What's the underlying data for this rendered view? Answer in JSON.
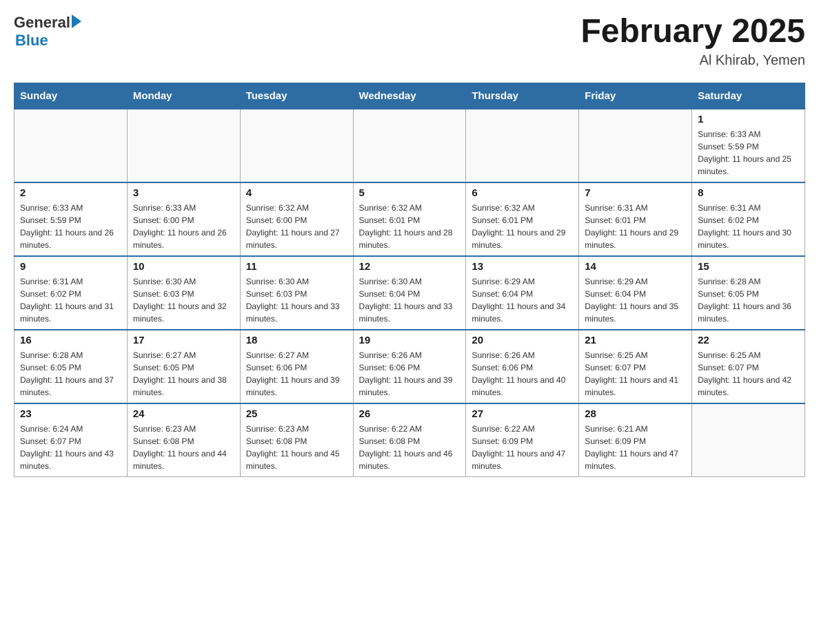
{
  "header": {
    "logo": {
      "general": "General",
      "blue": "Blue"
    },
    "title": "February 2025",
    "location": "Al Khirab, Yemen"
  },
  "days_of_week": [
    "Sunday",
    "Monday",
    "Tuesday",
    "Wednesday",
    "Thursday",
    "Friday",
    "Saturday"
  ],
  "weeks": [
    {
      "days": [
        {
          "num": "",
          "empty": true
        },
        {
          "num": "",
          "empty": true
        },
        {
          "num": "",
          "empty": true
        },
        {
          "num": "",
          "empty": true
        },
        {
          "num": "",
          "empty": true
        },
        {
          "num": "",
          "empty": true
        },
        {
          "num": "1",
          "sunrise": "Sunrise: 6:33 AM",
          "sunset": "Sunset: 5:59 PM",
          "daylight": "Daylight: 11 hours and 25 minutes."
        }
      ]
    },
    {
      "days": [
        {
          "num": "2",
          "sunrise": "Sunrise: 6:33 AM",
          "sunset": "Sunset: 5:59 PM",
          "daylight": "Daylight: 11 hours and 26 minutes."
        },
        {
          "num": "3",
          "sunrise": "Sunrise: 6:33 AM",
          "sunset": "Sunset: 6:00 PM",
          "daylight": "Daylight: 11 hours and 26 minutes."
        },
        {
          "num": "4",
          "sunrise": "Sunrise: 6:32 AM",
          "sunset": "Sunset: 6:00 PM",
          "daylight": "Daylight: 11 hours and 27 minutes."
        },
        {
          "num": "5",
          "sunrise": "Sunrise: 6:32 AM",
          "sunset": "Sunset: 6:01 PM",
          "daylight": "Daylight: 11 hours and 28 minutes."
        },
        {
          "num": "6",
          "sunrise": "Sunrise: 6:32 AM",
          "sunset": "Sunset: 6:01 PM",
          "daylight": "Daylight: 11 hours and 29 minutes."
        },
        {
          "num": "7",
          "sunrise": "Sunrise: 6:31 AM",
          "sunset": "Sunset: 6:01 PM",
          "daylight": "Daylight: 11 hours and 29 minutes."
        },
        {
          "num": "8",
          "sunrise": "Sunrise: 6:31 AM",
          "sunset": "Sunset: 6:02 PM",
          "daylight": "Daylight: 11 hours and 30 minutes."
        }
      ]
    },
    {
      "days": [
        {
          "num": "9",
          "sunrise": "Sunrise: 6:31 AM",
          "sunset": "Sunset: 6:02 PM",
          "daylight": "Daylight: 11 hours and 31 minutes."
        },
        {
          "num": "10",
          "sunrise": "Sunrise: 6:30 AM",
          "sunset": "Sunset: 6:03 PM",
          "daylight": "Daylight: 11 hours and 32 minutes."
        },
        {
          "num": "11",
          "sunrise": "Sunrise: 6:30 AM",
          "sunset": "Sunset: 6:03 PM",
          "daylight": "Daylight: 11 hours and 33 minutes."
        },
        {
          "num": "12",
          "sunrise": "Sunrise: 6:30 AM",
          "sunset": "Sunset: 6:04 PM",
          "daylight": "Daylight: 11 hours and 33 minutes."
        },
        {
          "num": "13",
          "sunrise": "Sunrise: 6:29 AM",
          "sunset": "Sunset: 6:04 PM",
          "daylight": "Daylight: 11 hours and 34 minutes."
        },
        {
          "num": "14",
          "sunrise": "Sunrise: 6:29 AM",
          "sunset": "Sunset: 6:04 PM",
          "daylight": "Daylight: 11 hours and 35 minutes."
        },
        {
          "num": "15",
          "sunrise": "Sunrise: 6:28 AM",
          "sunset": "Sunset: 6:05 PM",
          "daylight": "Daylight: 11 hours and 36 minutes."
        }
      ]
    },
    {
      "days": [
        {
          "num": "16",
          "sunrise": "Sunrise: 6:28 AM",
          "sunset": "Sunset: 6:05 PM",
          "daylight": "Daylight: 11 hours and 37 minutes."
        },
        {
          "num": "17",
          "sunrise": "Sunrise: 6:27 AM",
          "sunset": "Sunset: 6:05 PM",
          "daylight": "Daylight: 11 hours and 38 minutes."
        },
        {
          "num": "18",
          "sunrise": "Sunrise: 6:27 AM",
          "sunset": "Sunset: 6:06 PM",
          "daylight": "Daylight: 11 hours and 39 minutes."
        },
        {
          "num": "19",
          "sunrise": "Sunrise: 6:26 AM",
          "sunset": "Sunset: 6:06 PM",
          "daylight": "Daylight: 11 hours and 39 minutes."
        },
        {
          "num": "20",
          "sunrise": "Sunrise: 6:26 AM",
          "sunset": "Sunset: 6:06 PM",
          "daylight": "Daylight: 11 hours and 40 minutes."
        },
        {
          "num": "21",
          "sunrise": "Sunrise: 6:25 AM",
          "sunset": "Sunset: 6:07 PM",
          "daylight": "Daylight: 11 hours and 41 minutes."
        },
        {
          "num": "22",
          "sunrise": "Sunrise: 6:25 AM",
          "sunset": "Sunset: 6:07 PM",
          "daylight": "Daylight: 11 hours and 42 minutes."
        }
      ]
    },
    {
      "days": [
        {
          "num": "23",
          "sunrise": "Sunrise: 6:24 AM",
          "sunset": "Sunset: 6:07 PM",
          "daylight": "Daylight: 11 hours and 43 minutes."
        },
        {
          "num": "24",
          "sunrise": "Sunrise: 6:23 AM",
          "sunset": "Sunset: 6:08 PM",
          "daylight": "Daylight: 11 hours and 44 minutes."
        },
        {
          "num": "25",
          "sunrise": "Sunrise: 6:23 AM",
          "sunset": "Sunset: 6:08 PM",
          "daylight": "Daylight: 11 hours and 45 minutes."
        },
        {
          "num": "26",
          "sunrise": "Sunrise: 6:22 AM",
          "sunset": "Sunset: 6:08 PM",
          "daylight": "Daylight: 11 hours and 46 minutes."
        },
        {
          "num": "27",
          "sunrise": "Sunrise: 6:22 AM",
          "sunset": "Sunset: 6:09 PM",
          "daylight": "Daylight: 11 hours and 47 minutes."
        },
        {
          "num": "28",
          "sunrise": "Sunrise: 6:21 AM",
          "sunset": "Sunset: 6:09 PM",
          "daylight": "Daylight: 11 hours and 47 minutes."
        },
        {
          "num": "",
          "empty": true
        }
      ]
    }
  ]
}
